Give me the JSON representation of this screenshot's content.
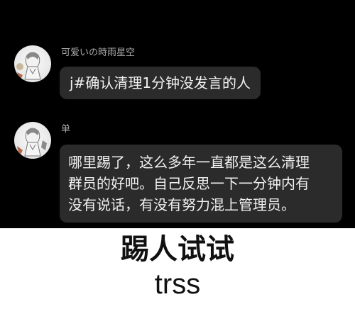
{
  "messages": [
    {
      "sender": "可爱いの時雨星空",
      "text_lines": [
        "j#确认清理1分钟没发言的人"
      ],
      "avatar_icon": "anime-girl-avatar-icon"
    },
    {
      "sender": "单",
      "text_lines": [
        "哪里踢了，这么多年一直都是这么清理",
        "群员的好吧。自己反思一下一分钟内有",
        "没有说话，有没有努力混上管理员。"
      ],
      "avatar_icon": "anime-girl-avatar-icon"
    }
  ],
  "caption": {
    "main": "踢人试试",
    "sub": "trss"
  },
  "colors": {
    "chat_background": "#000000",
    "bubble_background": "#2b2b2b",
    "sender_text": "#a9a9a9",
    "bubble_text": "#f1f1f1",
    "caption_background": "#ffffff",
    "caption_text": "#111111"
  }
}
